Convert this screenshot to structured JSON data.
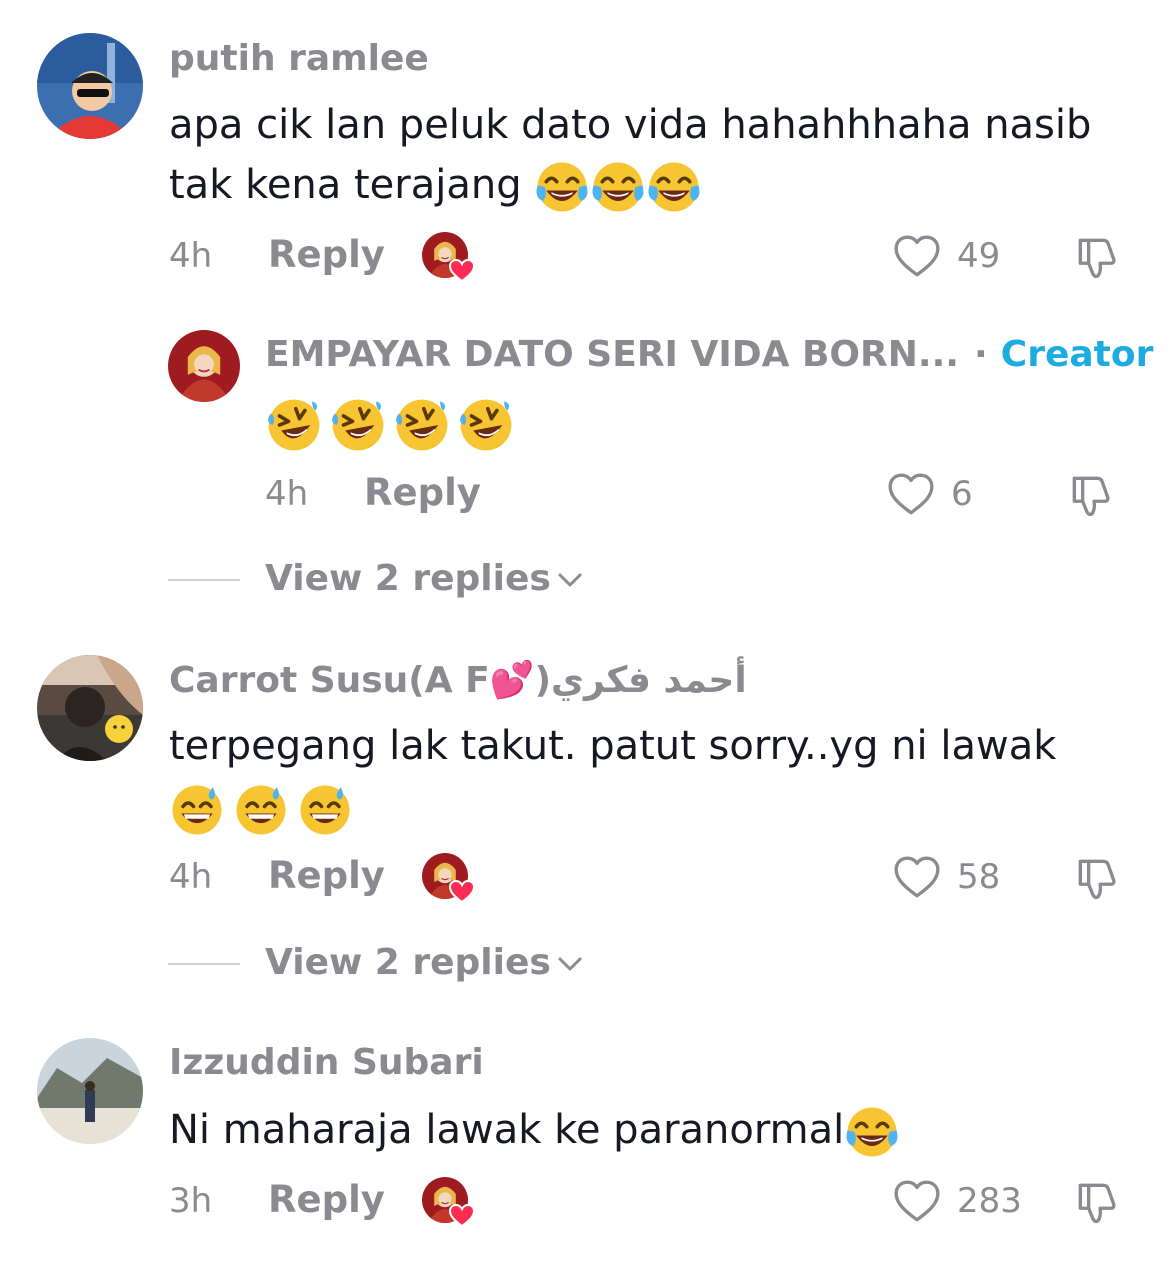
{
  "comments": [
    {
      "username": "putih ramlee",
      "text_line1": "apa cik lan peluk dato vida hahahhhaha nasib",
      "text_line2": "tak kena terajang",
      "time": "4h",
      "reply_label": "Reply",
      "likes": "49",
      "emoji_icon": "face-with-tears-of-joy-icon",
      "creator_liked": true
    },
    {
      "username": "EMPAYAR DATO SERI VIDA BORN...",
      "badge_separator": "·",
      "badge": "Creator",
      "time": "4h",
      "reply_label": "Reply",
      "likes": "6",
      "emoji_icon": "rolling-on-floor-laughing-icon"
    },
    {
      "username": "Carrot Susu(A F💕)أحمد فكري",
      "text_line1": "terpegang lak takut. patut sorry..yg ni lawak",
      "time": "4h",
      "reply_label": "Reply",
      "likes": "58",
      "emoji_icon": "grinning-face-with-sweat-icon",
      "creator_liked": true
    },
    {
      "username": "Izzuddin Subari",
      "text_line1": "Ni maharaja lawak ke paranormal",
      "time": "3h",
      "reply_label": "Reply",
      "likes": "283",
      "emoji_icon": "face-with-tears-of-joy-icon",
      "creator_liked": true
    }
  ],
  "view_replies": [
    {
      "label": "View 2 replies"
    },
    {
      "label": "View 2 replies"
    }
  ],
  "colors": {
    "text_primary": "#161823",
    "text_secondary": "#8a8b91",
    "creator_badge": "#1dace0",
    "like_heart": "#fe2c55"
  }
}
